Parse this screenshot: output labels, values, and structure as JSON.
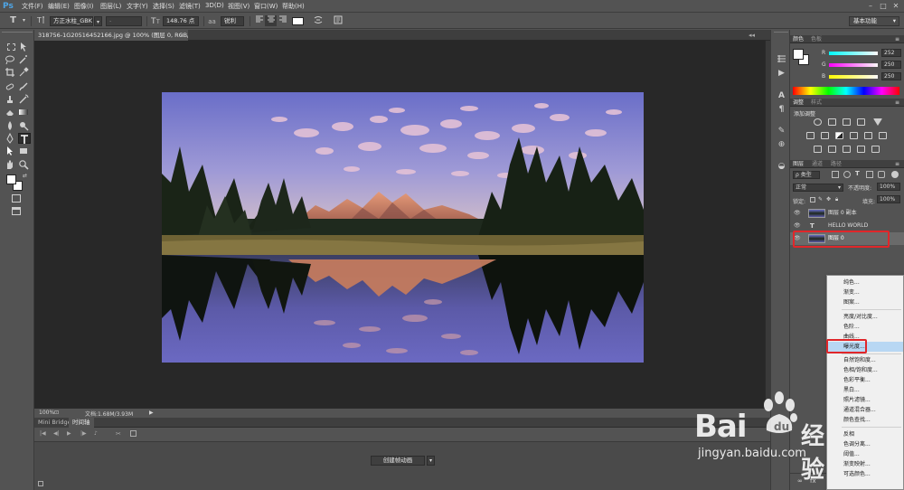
{
  "app": {
    "logo": "Ps"
  },
  "menu": [
    "文件(F)",
    "编辑(E)",
    "图像(I)",
    "图层(L)",
    "文字(Y)",
    "选择(S)",
    "滤镜(T)",
    "3D(D)",
    "视图(V)",
    "窗口(W)",
    "帮助(H)"
  ],
  "options": {
    "tool_icon": "T",
    "font_family": "方正水柱_GBK",
    "font_style": "-",
    "font_size": "148.76 点",
    "aa_label": "aa",
    "aa_mode": "锐利",
    "workspace": "基本功能"
  },
  "document": {
    "tab_title": "318756-1G20516452166.jpg @ 100% (图层 0, RGB/8#) *",
    "zoom": "100%",
    "doc_info": "文档:1.68M/3.93M"
  },
  "bottom_tabs": [
    "Mini Bridge",
    "时间轴"
  ],
  "timeline": {
    "create_button": "创建帧动画"
  },
  "color_panel": {
    "tabs": [
      "颜色",
      "色板"
    ],
    "channels": [
      {
        "label": "R",
        "value": "252"
      },
      {
        "label": "G",
        "value": "250"
      },
      {
        "label": "B",
        "value": "250"
      }
    ]
  },
  "adjust_panel": {
    "tabs": [
      "调整",
      "样式"
    ],
    "title": "添加调整"
  },
  "layers_panel": {
    "tabs": [
      "图层",
      "通道",
      "路径"
    ],
    "filter_kind": "ρ 类型",
    "blend_mode": "正常",
    "opacity_label": "不透明度:",
    "opacity_value": "100%",
    "lock_label": "锁定:",
    "fill_label": "填充:",
    "fill_value": "100%",
    "layers": [
      {
        "name": "图层 0 副本",
        "kind": "image"
      },
      {
        "name": "HELLO WORLD",
        "kind": "text",
        "type_glyph": "T"
      },
      {
        "name": "图层 0",
        "kind": "image"
      }
    ]
  },
  "context_menu": {
    "items": [
      {
        "label": "纯色..."
      },
      {
        "label": "渐变..."
      },
      {
        "label": "图案..."
      },
      {
        "label": "亮度/对比度..."
      },
      {
        "label": "色阶..."
      },
      {
        "label": "曲线..."
      },
      {
        "label": "曝光度...",
        "highlighted": true
      },
      {
        "label": "自然饱和度..."
      },
      {
        "label": "色相/饱和度..."
      },
      {
        "label": "色彩平衡..."
      },
      {
        "label": "黑白..."
      },
      {
        "label": "照片滤镜..."
      },
      {
        "label": "通道混合器..."
      },
      {
        "label": "颜色查找..."
      },
      {
        "label": "反相"
      },
      {
        "label": "色调分离..."
      },
      {
        "label": "阈值..."
      },
      {
        "label": "渐变映射..."
      },
      {
        "label": "可选颜色..."
      }
    ]
  },
  "watermark": {
    "brand": "Bai",
    "brand_cn": "经验",
    "url": "jingyan.baidu.com"
  }
}
